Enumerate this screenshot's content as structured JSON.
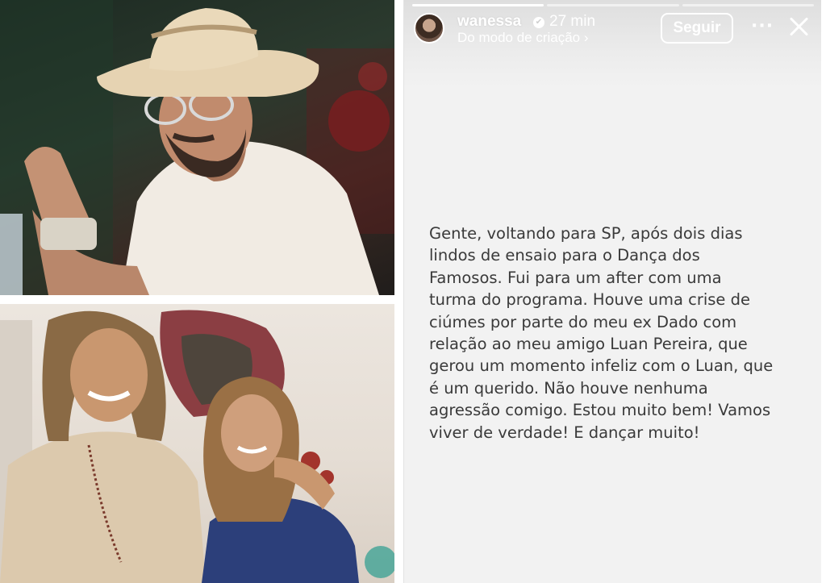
{
  "story": {
    "username": "wanessa",
    "verified_icon": "verified-badge-icon",
    "time": "27 min",
    "subtitle": "Do modo de criação",
    "subtitle_chevron": "›",
    "follow_label": "Seguir",
    "more_label": "···",
    "close_icon": "close-icon",
    "progress_segments": 3,
    "progress_done": 1,
    "message_lines": [
      "Gente, voltando para SP, após dois dias",
      "lindos de ensaio para o Dança dos",
      "Famosos. Fui para um after com uma",
      "turma do programa. Houve uma crise de",
      "ciúmes por parte do meu ex Dado com",
      "relação ao meu amigo Luan Pereira, que",
      "gerou um momento infeliz com o Luan, que",
      "é um querido. Não houve nenhuma",
      "agressão comigo. Estou muito bem! Vamos",
      "viver de verdade! E dançar muito!"
    ]
  },
  "colors": {
    "story_background": "#f2f2f2",
    "message_text": "#3a3a3a",
    "header_text": "#ffffff"
  }
}
